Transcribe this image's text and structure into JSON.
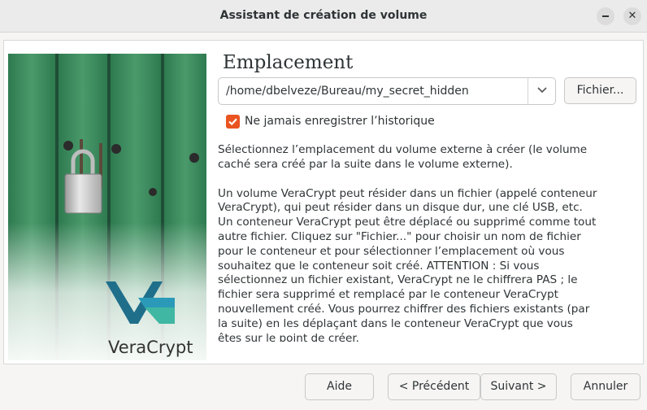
{
  "window": {
    "title": "Assistant de création de volume"
  },
  "branding": {
    "logo_text": "VeraCrypt"
  },
  "page": {
    "heading": "Emplacement",
    "location_value": "/home/dbelveze/Bureau/my_secret_hidden",
    "file_button": "Fichier...",
    "never_save_history": {
      "label": "Ne jamais enregistrer l’historique",
      "checked": true
    },
    "description": [
      "Sélectionnez l’emplacement du volume externe à créer (le volume caché sera créé par la suite dans le volume externe).",
      "Un volume VeraCrypt peut résider dans un fichier (appelé conteneur VeraCrypt), qui peut résider dans un disque dur, une clé USB, etc. Un conteneur VeraCrypt peut être déplacé ou supprimé comme tout autre fichier. Cliquez sur \"Fichier...\" pour choisir un nom de fichier pour le conteneur et pour sélectionner l’emplacement où vous souhaitez que le conteneur soit créé. ATTENTION : Si vous sélectionnez un fichier existant, VeraCrypt ne le chiffrera PAS ; le fichier sera supprimé et remplacé par le conteneur VeraCrypt nouvellement créé. Vous pourrez chiffrer des fichiers existants (par la suite) en les déplaçant dans le conteneur VeraCrypt que vous êtes sur le point de créer."
    ]
  },
  "footer": {
    "help": "Aide",
    "previous": "< Précédent",
    "next": "Suivant >",
    "cancel": "Annuler"
  },
  "colors": {
    "accent": "#e95420",
    "door_green": "#3d8a5e"
  },
  "icons": {
    "minimize": "minimize-icon",
    "close": "close-icon",
    "dropdown": "chevron-down-icon",
    "checkbox": "checkmark-icon",
    "padlock": "padlock-icon",
    "logo": "veracrypt-logo-icon"
  }
}
